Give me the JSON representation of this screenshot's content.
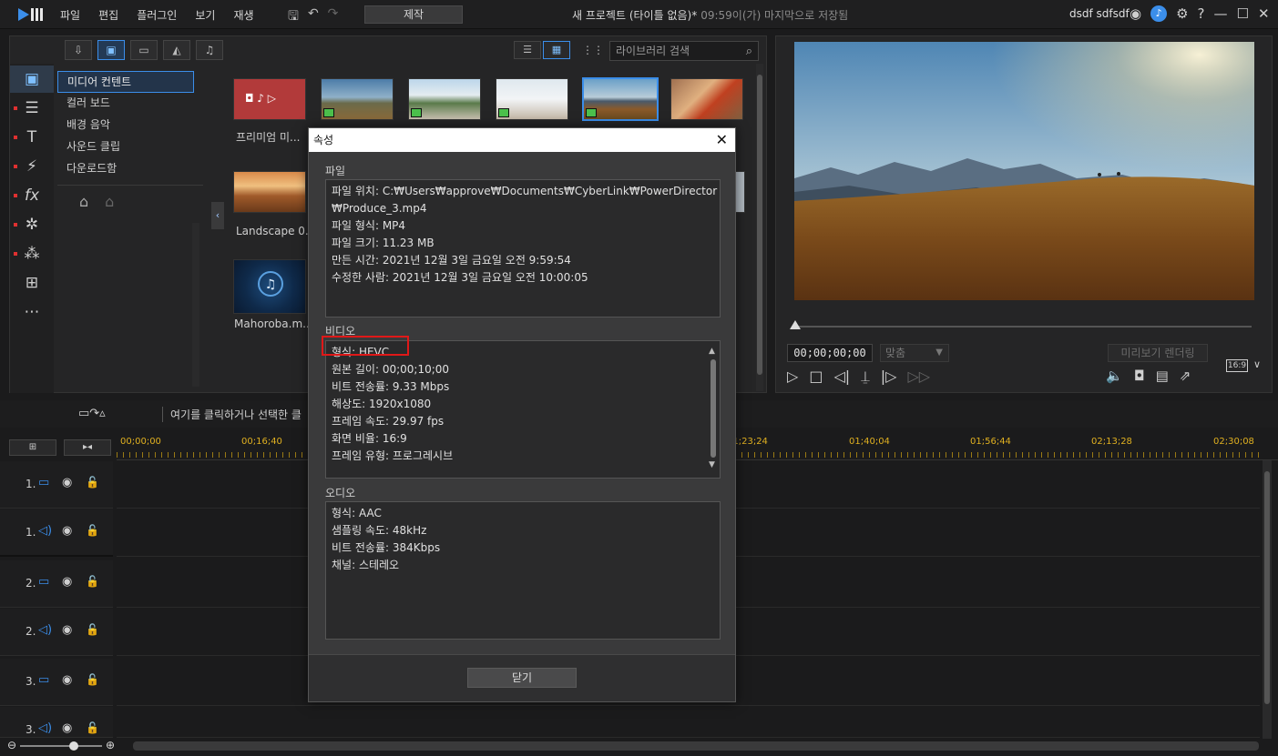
{
  "app": {
    "menu": [
      "파일",
      "편집",
      "플러그인",
      "보기",
      "재생"
    ],
    "produce_label": "제작",
    "project_title": "새 프로젝트 (타이틀 없음)*",
    "last_saved": "09:59이(가) 마지막으로 저장됨",
    "user_name": "dsdf sdfsdf",
    "icons": [
      "save-icon",
      "undo-icon",
      "redo-icon",
      "account-icon",
      "bell-icon",
      "gear-icon",
      "help-icon",
      "minimize-icon",
      "maximize-icon",
      "close-icon"
    ]
  },
  "library": {
    "search_placeholder": "라이브러리 검색",
    "folders": [
      "미디어 컨텐트",
      "컬러 보드",
      "배경 음악",
      "사운드 클립",
      "다운로드함"
    ],
    "selected_folder": "미디어 컨텐트",
    "items": [
      {
        "caption": "프리미엄 미..."
      },
      {
        "caption": "Landscape 0..."
      },
      {
        "caption": "Mahoroba.m..."
      }
    ]
  },
  "preview": {
    "timecode": "00;00;00;00",
    "fit_label": "맞춤",
    "render_label": "미리보기 렌더링",
    "aspect": "16:9"
  },
  "timeline": {
    "hint": "여기를 클릭하거나 선택한 클",
    "ruler": [
      "00;00;00",
      "00;16;40",
      "01;23;24",
      "01;40;04",
      "01;56;44",
      "02;13;28",
      "02;30;08"
    ],
    "tracks": [
      {
        "num": "1.",
        "kind": "video"
      },
      {
        "num": "1.",
        "kind": "audio"
      },
      {
        "num": "2.",
        "kind": "video"
      },
      {
        "num": "2.",
        "kind": "audio"
      },
      {
        "num": "3.",
        "kind": "video"
      },
      {
        "num": "3.",
        "kind": "audio"
      }
    ]
  },
  "dialog": {
    "title": "속성",
    "file_section": "파일",
    "file_lines": [
      "파일 위치: C:₩Users₩approve₩Documents₩CyberLink₩PowerDirector",
      "₩Produce_3.mp4",
      "파일 형식: MP4",
      "파일 크기: 11.23 MB",
      "만든 시간: 2021년 12월 3일 금요일 오전 9:59:54",
      "수정한 사람: 2021년 12월 3일 금요일 오전 10:00:05"
    ],
    "video_section": "비디오",
    "video_lines": [
      "형식: HEVC",
      "원본 길이: 00;00;10;00",
      "비트 전송률: 9.33 Mbps",
      "해상도: 1920x1080",
      "프레임 속도: 29.97 fps",
      "화면 비율: 16:9",
      "프레임 유형: 프로그레시브"
    ],
    "audio_section": "오디오",
    "audio_lines": [
      "형식: AAC",
      "샘플링 속도: 48kHz",
      "비트 전송률: 384Kbps",
      "채널: 스테레오"
    ],
    "close_button": "닫기"
  }
}
